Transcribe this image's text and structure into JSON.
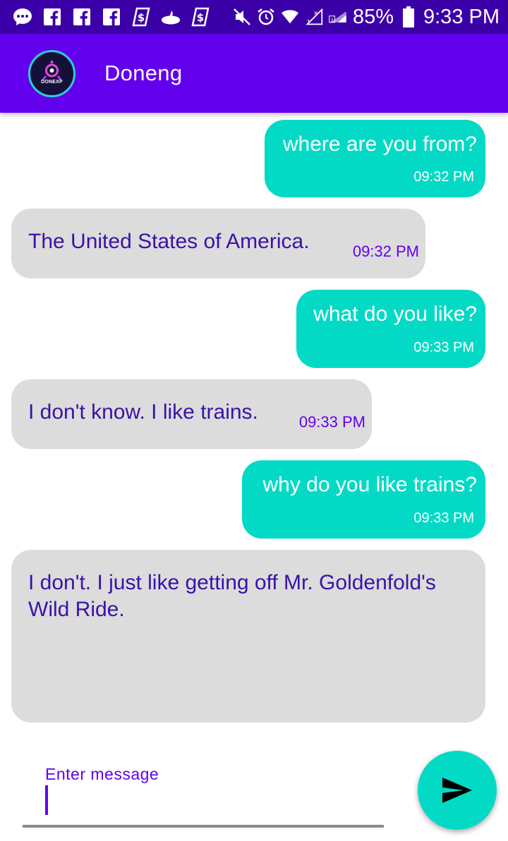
{
  "status_bar": {
    "battery_percent": "85%",
    "time": "9:33 PM",
    "left_icons": [
      "messenger-icon",
      "facebook-icon",
      "facebook-icon",
      "facebook-icon",
      "dollar-app-icon",
      "santander-icon",
      "dollar-app-icon"
    ],
    "right_icons": [
      "mute-icon",
      "alarm-icon",
      "wifi-icon",
      "signal-1-icon",
      "signal-2-icon",
      "battery-icon"
    ]
  },
  "app_bar": {
    "title": "Doneng",
    "avatar_text": "DONEXP"
  },
  "messages": [
    {
      "sender": "user",
      "text": "where are you from?",
      "time": "09:32 PM"
    },
    {
      "sender": "bot",
      "text": "The United States of America.",
      "time": "09:32 PM"
    },
    {
      "sender": "user",
      "text": "what do you like?",
      "time": "09:33 PM"
    },
    {
      "sender": "bot",
      "text": "I don't know. I like trains.",
      "time": "09:33 PM"
    },
    {
      "sender": "user",
      "text": "why do you like trains?",
      "time": "09:33 PM"
    },
    {
      "sender": "bot",
      "text": "I don't. I just like getting off Mr. Goldenfold's Wild Ride.",
      "time": ""
    }
  ],
  "composer": {
    "label": "Enter message",
    "value": ""
  },
  "colors": {
    "status_bar": "#3c00a8",
    "primary": "#6200ee",
    "accent": "#03dac5",
    "received_bubble": "#dcdcdc",
    "received_text": "#3a12a8"
  }
}
